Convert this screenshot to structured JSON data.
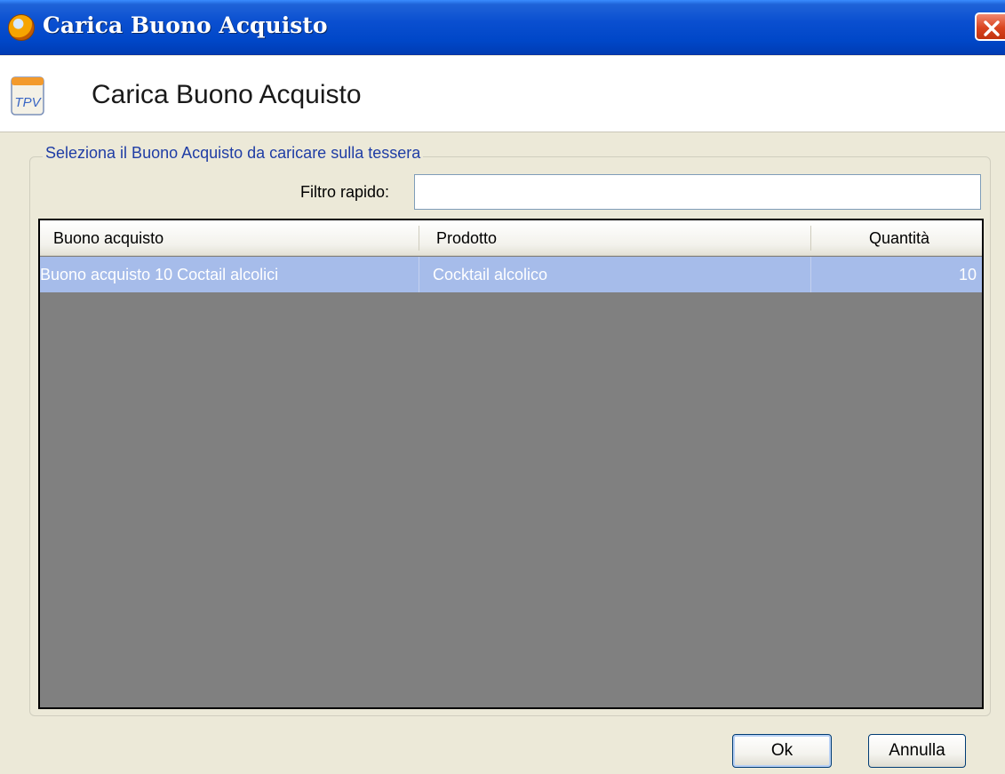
{
  "window": {
    "title": "Carica Buono Acquisto",
    "close_icon": "close-icon"
  },
  "header": {
    "icon_text": "TPV",
    "title": "Carica Buono Acquisto"
  },
  "group": {
    "legend": "Seleziona il Buono Acquisto da caricare sulla tessera",
    "filter_label": "Filtro rapido:",
    "filter_value": ""
  },
  "grid": {
    "columns": [
      "Buono acquisto",
      "Prodotto",
      "Quantità"
    ],
    "rows": [
      {
        "buono": "Buono acquisto 10 Coctail alcolici",
        "prodotto": "Cocktail alcolico",
        "quantita": "10",
        "selected": true
      }
    ]
  },
  "buttons": {
    "ok": "Ok",
    "cancel": "Annulla"
  },
  "colors": {
    "titlebar": "#0a4fd0",
    "selection": "#a6bcea",
    "grid_background": "#808080",
    "legend_text": "#1f3da5"
  }
}
